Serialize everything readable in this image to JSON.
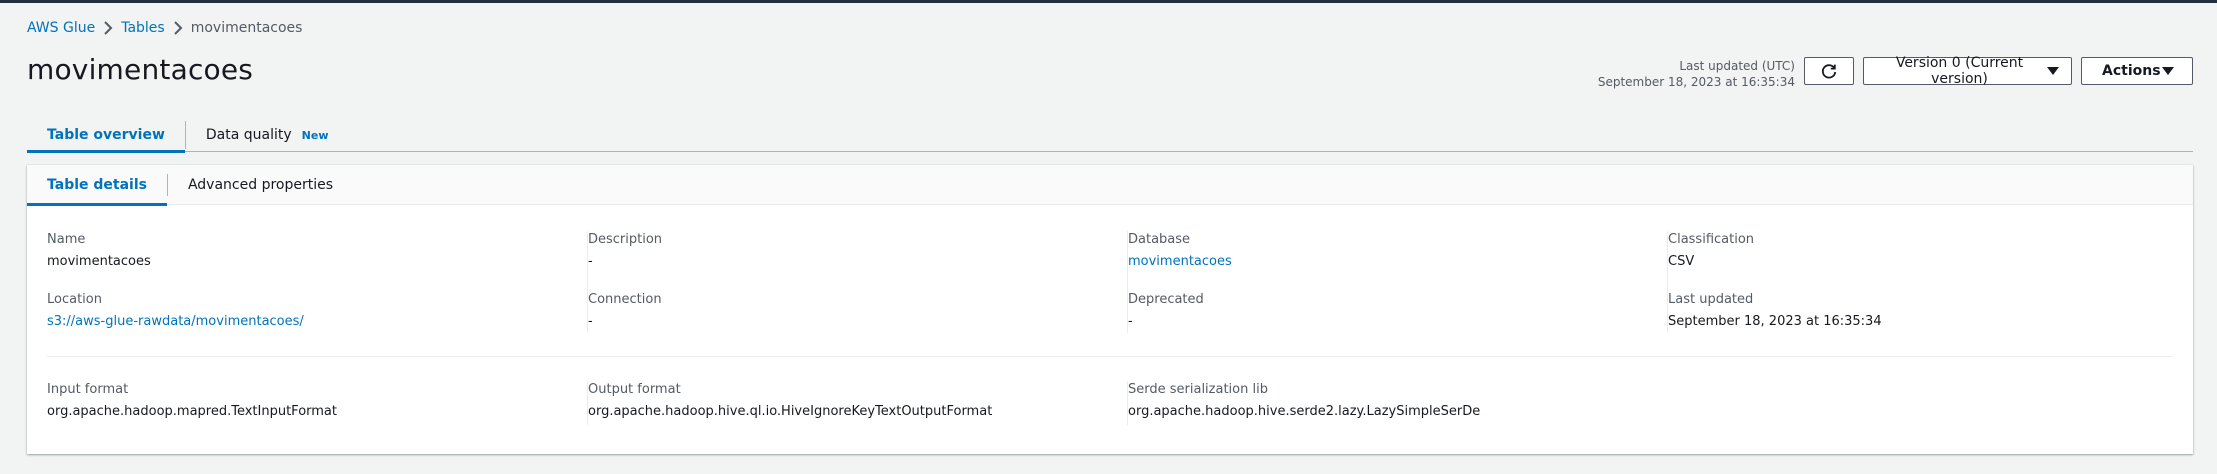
{
  "breadcrumb": {
    "items": [
      "AWS Glue",
      "Tables"
    ],
    "current": "movimentacoes"
  },
  "page": {
    "title": "movimentacoes"
  },
  "header": {
    "last_updated_label": "Last updated (UTC)",
    "last_updated_value": "September 18, 2023 at 16:35:34",
    "version_label": "Version 0 (Current version)",
    "actions_label": "Actions"
  },
  "outer_tabs": {
    "overview": "Table overview",
    "quality": "Data quality",
    "quality_badge": "New"
  },
  "inner_tabs": {
    "details": "Table details",
    "advanced": "Advanced properties"
  },
  "details": {
    "name_label": "Name",
    "name_value": "movimentacoes",
    "description_label": "Description",
    "description_value": "-",
    "database_label": "Database",
    "database_value": "movimentacoes",
    "classification_label": "Classification",
    "classification_value": "CSV",
    "location_label": "Location",
    "location_value": "s3://aws-glue-rawdata/movimentacoes/",
    "connection_label": "Connection",
    "connection_value": "-",
    "deprecated_label": "Deprecated",
    "deprecated_value": "-",
    "last_updated_label": "Last updated",
    "last_updated_value": "September 18, 2023 at 16:35:34",
    "input_format_label": "Input format",
    "input_format_value": "org.apache.hadoop.mapred.TextInputFormat",
    "output_format_label": "Output format",
    "output_format_value": "org.apache.hadoop.hive.ql.io.HiveIgnoreKeyTextOutputFormat",
    "serde_label": "Serde serialization lib",
    "serde_value": "org.apache.hadoop.hive.serde2.lazy.LazySimpleSerDe"
  },
  "icons": {
    "refresh": "refresh-icon",
    "chevron": "chevron-right-icon",
    "caret": "caret-down-icon"
  },
  "colors": {
    "link": "#0073bb",
    "text": "#16191f",
    "muted": "#545b64",
    "background": "#f2f3f3"
  }
}
